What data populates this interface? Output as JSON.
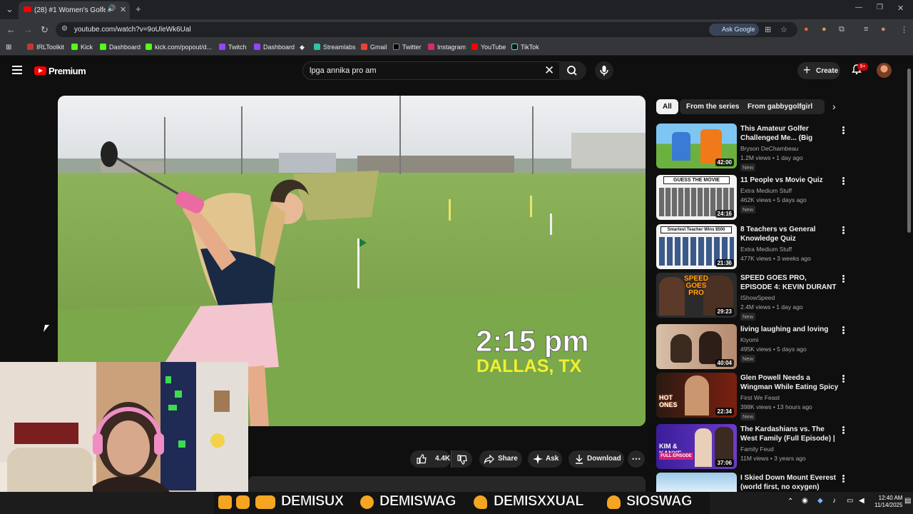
{
  "browser": {
    "tab_title": "(28) #1 Women's Golfer In",
    "url": "youtube.com/watch?v=9oUleWk6Ual",
    "ask_google": "Ask Google",
    "bookmarks": [
      "IRLToolkit",
      "Kick",
      "Dashboard",
      "kick.com/popout/d...",
      "Twitch",
      "Dashboard",
      "Streamlabs",
      "Gmail",
      "Twitter",
      "Instagram",
      "YouTube",
      "TikTok"
    ]
  },
  "youtube": {
    "brand": "Premium",
    "search_query": "lpga annika pro am",
    "create_label": "Create",
    "notification_count": "9+"
  },
  "video": {
    "overlay_time": "2:15 pm",
    "overlay_location": "DALLAS, TX"
  },
  "actions": {
    "likes": "4.4K",
    "share": "Share",
    "ask": "Ask",
    "download": "Download"
  },
  "sidebar": {
    "chips": [
      "All",
      "From the series",
      "From gabbygolfgirl"
    ],
    "videos": [
      {
        "title": "This Amateur Golfer Challenged Me... (Big Mistake?)",
        "channel": "Bryson DeChambeau",
        "meta": "1.2M views • 1 day ago",
        "badge": "New",
        "duration": "42:00"
      },
      {
        "title": "11 People vs Movie Quiz",
        "channel": "Extra Medium Stuff",
        "meta": "462K views • 5 days ago",
        "badge": "New",
        "duration": "24:16"
      },
      {
        "title": "8 Teachers vs General Knowledge Quiz",
        "channel": "Extra Medium Stuff",
        "meta": "477K views • 3 weeks ago",
        "badge": "",
        "duration": "21:36"
      },
      {
        "title": "SPEED GOES PRO, EPISODE 4: KEVIN DURANT",
        "channel": "IShowSpeed",
        "meta": "2.4M views • 1 day ago",
        "badge": "New",
        "duration": "29:23"
      },
      {
        "title": "living laughing and loving",
        "channel": "Kiyomi",
        "meta": "495K views • 5 days ago",
        "badge": "New",
        "duration": "40:04"
      },
      {
        "title": "Glen Powell Needs a Wingman While Eating Spicy Wings | Hot...",
        "channel": "First We Feast",
        "meta": "398K views • 13 hours ago",
        "badge": "New",
        "duration": "22:34"
      },
      {
        "title": "The Kardashians vs. The West Family (Full Episode) | Celebrit...",
        "channel": "Family Feud",
        "meta": "11M views • 3 years ago",
        "badge": "",
        "duration": "37:06"
      },
      {
        "title": "I Skied Down Mount Everest (world first, no oxygen)",
        "channel": "",
        "meta": "",
        "badge": "",
        "duration": ""
      }
    ],
    "thumb_texts": {
      "t2": "GUESS THE MOVIE",
      "t3": "Smartest Teacher Wins $500",
      "t4": "SPEED GOES PRO",
      "t6": "HOT ONES",
      "t7": "KIM & KANYE",
      "t7b": "FULL EPISODE"
    }
  },
  "stream_banner": {
    "handles": [
      "DEMISUX",
      "DEMISWAG",
      "DEMISXXUAL",
      "SIOSWAG"
    ]
  },
  "taskbar": {
    "time": "12:40 AM",
    "date": "11/14/2025"
  }
}
